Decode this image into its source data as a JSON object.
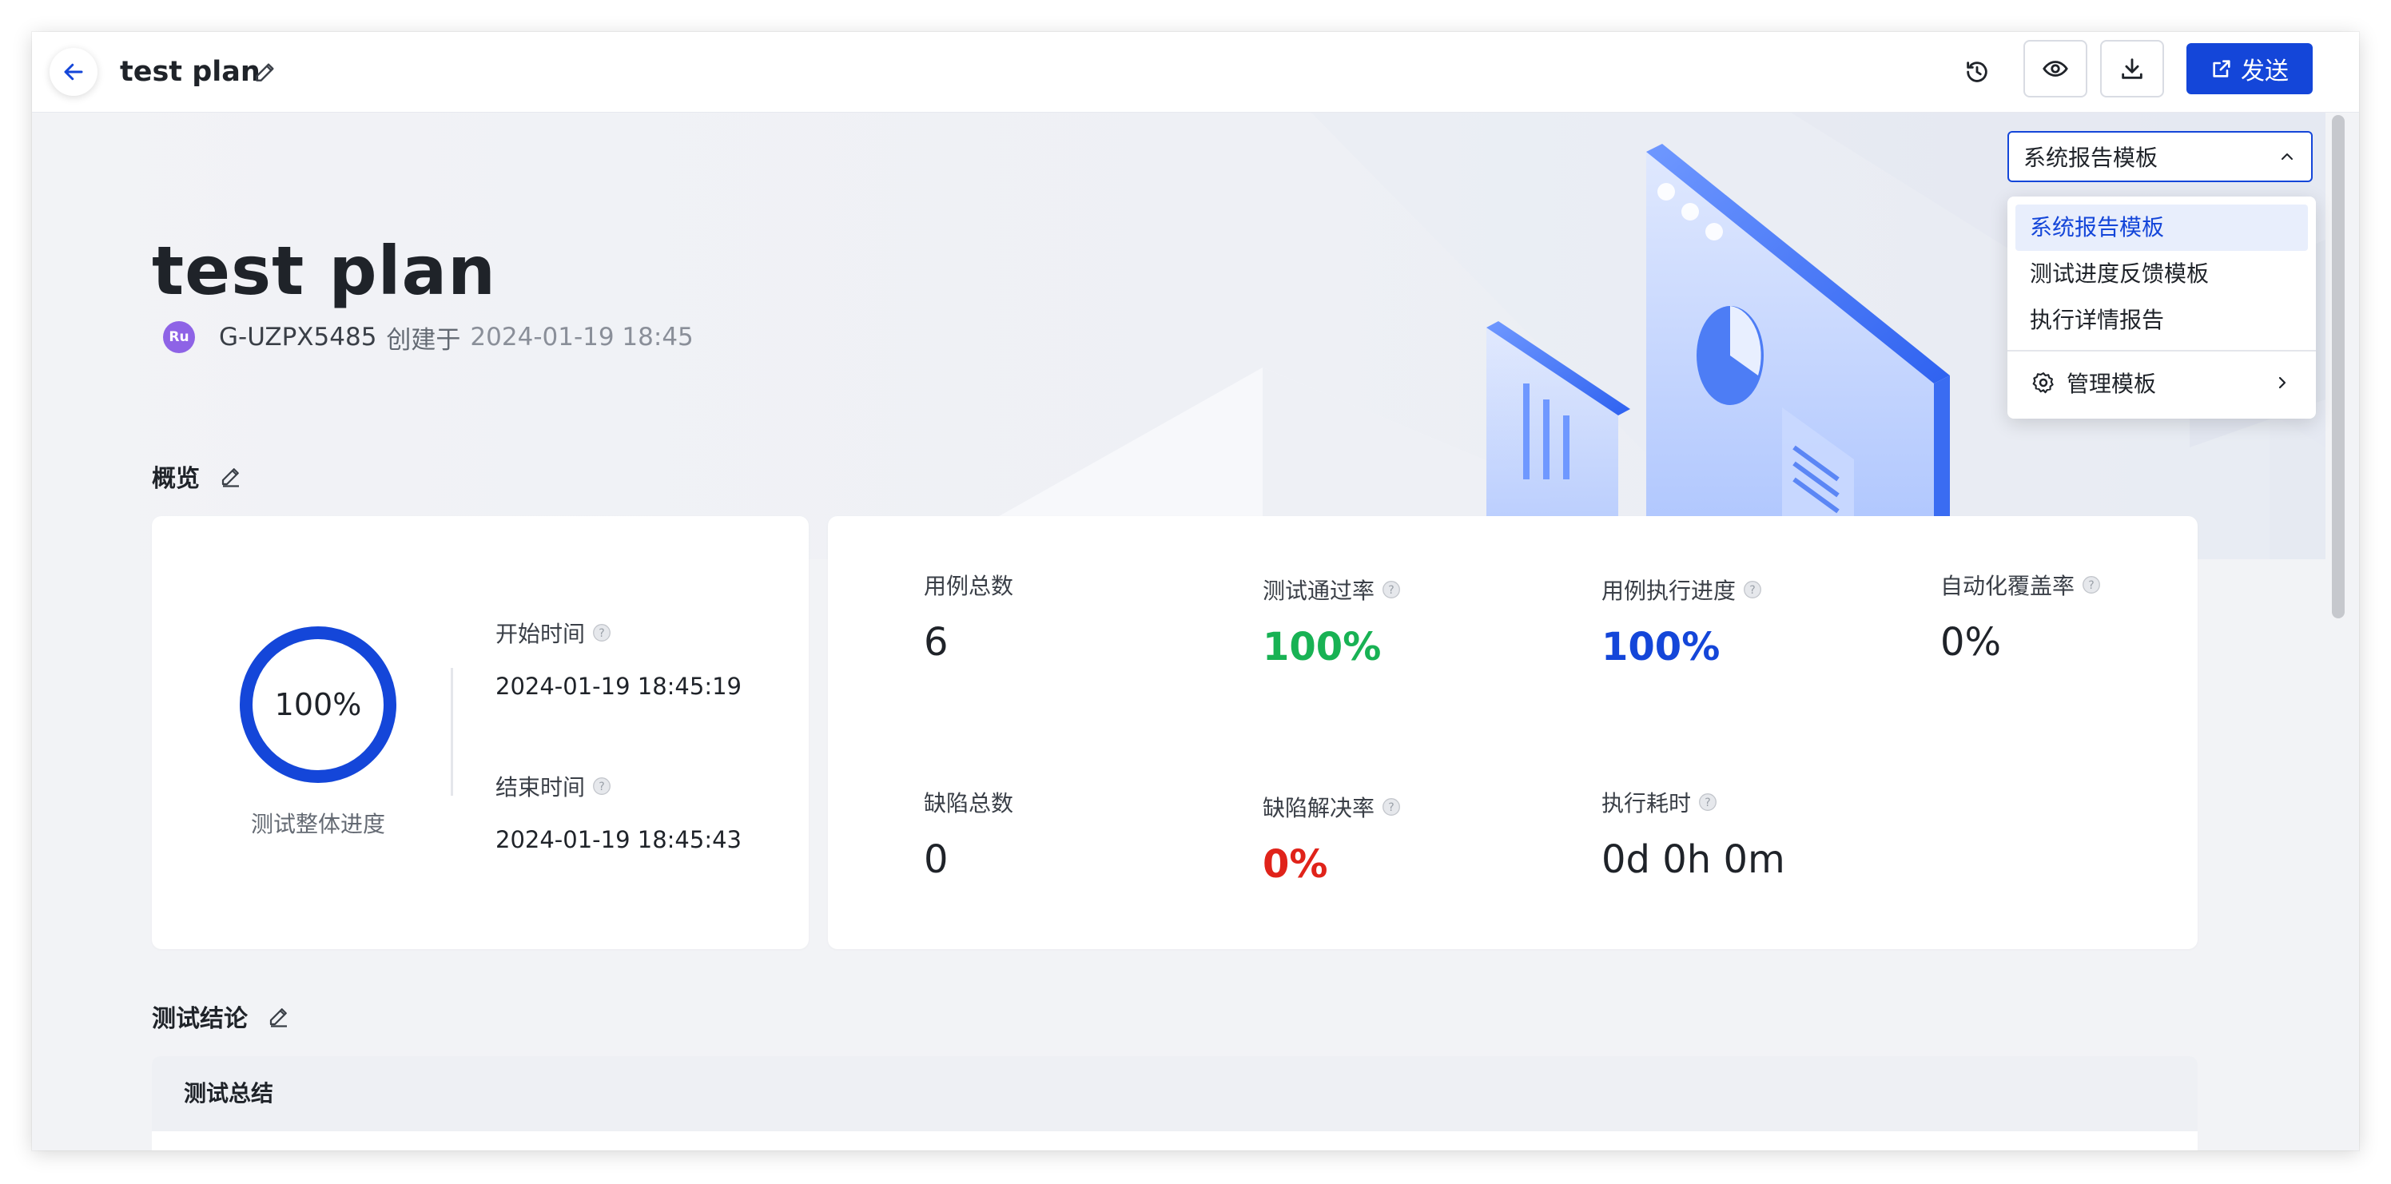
{
  "header": {
    "title": "test plan",
    "send_label": "发送"
  },
  "hero": {
    "title": "test plan",
    "avatar_text": "Ru",
    "creator": "G-UZPX5485",
    "created_label": "创建于",
    "created_time": "2024-01-19 18:45"
  },
  "template": {
    "selected": "系统报告模板",
    "options": [
      "系统报告模板",
      "测试进度反馈模板",
      "执行详情报告"
    ],
    "manage_label": "管理模板"
  },
  "overview": {
    "title": "概览",
    "progress_percent": "100%",
    "progress_fraction": 1.0,
    "progress_caption": "测试整体进度",
    "start_label": "开始时间",
    "start_time": "2024-01-19 18:45:19",
    "end_label": "结束时间",
    "end_time": "2024-01-19 18:45:43",
    "stats": [
      {
        "label": "用例总数",
        "value": "6",
        "help": false
      },
      {
        "label": "测试通过率",
        "value": "100%",
        "help": true
      },
      {
        "label": "用例执行进度",
        "value": "100%",
        "help": true
      },
      {
        "label": "自动化覆盖率",
        "value": "0%",
        "help": true
      },
      {
        "label": "缺陷总数",
        "value": "0",
        "help": false
      },
      {
        "label": "缺陷解决率",
        "value": "0%",
        "help": true
      },
      {
        "label": "执行耗时",
        "value": "0d 0h 0m",
        "help": true
      }
    ]
  },
  "conclusion": {
    "title": "测试结论",
    "summary_title": "测试总结"
  },
  "colors": {
    "primary": "#1446d9",
    "success": "#18b254",
    "danger": "#e0231a",
    "avatar": "#8e63e6"
  },
  "icons": [
    "back-arrow-icon",
    "pencil-icon",
    "history-icon",
    "eye-icon",
    "download-icon",
    "external-link-icon",
    "chevron-up-icon",
    "gear-icon",
    "chevron-right-icon",
    "help-icon"
  ]
}
